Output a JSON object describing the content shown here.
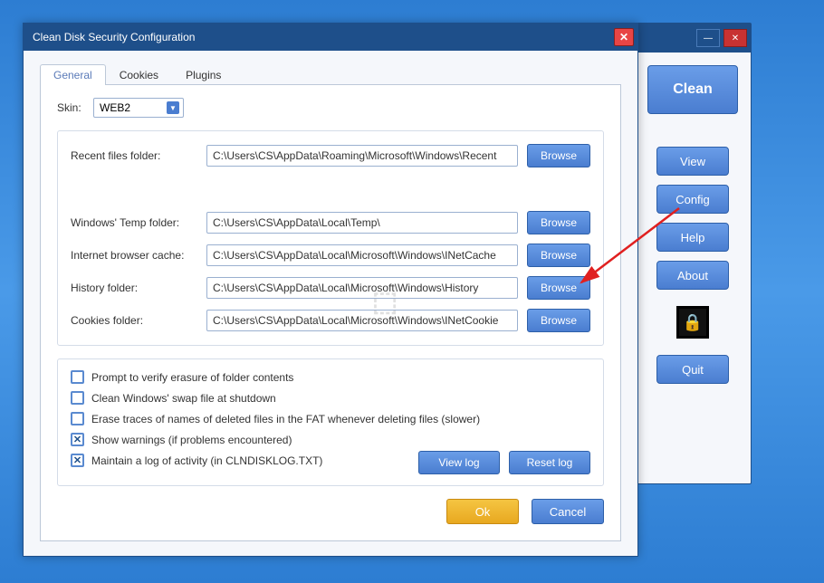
{
  "dialog": {
    "title": "Clean Disk Security Configuration",
    "tabs": {
      "general": "General",
      "cookies": "Cookies",
      "plugins": "Plugins"
    },
    "skin_label": "Skin:",
    "skin_value": "WEB2",
    "folders": {
      "recent_label": "Recent files folder:",
      "recent_value": "C:\\Users\\CS\\AppData\\Roaming\\Microsoft\\Windows\\Recent",
      "temp_label": "Windows' Temp folder:",
      "temp_value": "C:\\Users\\CS\\AppData\\Local\\Temp\\",
      "cache_label": "Internet browser cache:",
      "cache_value": "C:\\Users\\CS\\AppData\\Local\\Microsoft\\Windows\\INetCache",
      "history_label": "History folder:",
      "history_value": "C:\\Users\\CS\\AppData\\Local\\Microsoft\\Windows\\History",
      "cookies_label": "Cookies folder:",
      "cookies_value": "C:\\Users\\CS\\AppData\\Local\\Microsoft\\Windows\\INetCookie",
      "browse": "Browse"
    },
    "options": {
      "prompt": "Prompt to verify erasure of folder contents",
      "swap": "Clean Windows' swap file at shutdown",
      "fat": "Erase traces of names of deleted files in the FAT whenever deleting files (slower)",
      "warnings": "Show warnings (if problems encountered)",
      "log": "Maintain a log of activity (in CLNDISKLOG.TXT)",
      "view_log": "View log",
      "reset_log": "Reset log"
    },
    "ok": "Ok",
    "cancel": "Cancel"
  },
  "main": {
    "clean": "Clean",
    "view": "View",
    "config": "Config",
    "help": "Help",
    "about": "About",
    "quit": "Quit"
  }
}
